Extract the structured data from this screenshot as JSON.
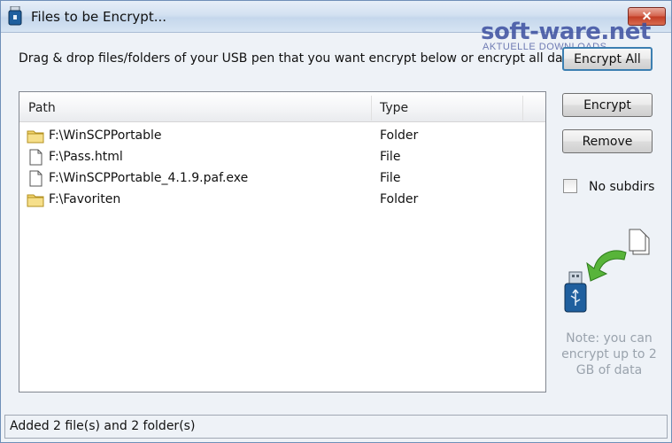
{
  "window": {
    "title": "Files to be Encrypt...",
    "close_icon": "close-icon"
  },
  "watermark": {
    "main": "soft-ware.net",
    "sub": "AKTUELLE DOWNLOADS"
  },
  "instruction": "Drag & drop files/folders of your USB pen that you want encrypt below or encrypt all data.",
  "buttons": {
    "encrypt_all": "Encrypt All",
    "encrypt": "Encrypt",
    "remove": "Remove"
  },
  "list": {
    "columns": {
      "path": "Path",
      "type": "Type"
    },
    "rows": [
      {
        "icon": "folder-icon",
        "path": "F:\\WinSCPPortable",
        "type": "Folder"
      },
      {
        "icon": "file-icon",
        "path": "F:\\Pass.html",
        "type": "File"
      },
      {
        "icon": "file-icon",
        "path": "F:\\WinSCPPortable_4.1.9.paf.exe",
        "type": "File"
      },
      {
        "icon": "folder-icon",
        "path": "F:\\Favoriten",
        "type": "Folder"
      }
    ]
  },
  "options": {
    "no_subdirs_label": "No subdirs",
    "no_subdirs_checked": false
  },
  "note": "Note: you can encrypt up to 2 GB of data",
  "status": "Added 2 file(s) and 2 folder(s)",
  "colors": {
    "folder": "#f2d36b",
    "arrow": "#58b43a",
    "usb": "#1f5f9e"
  }
}
